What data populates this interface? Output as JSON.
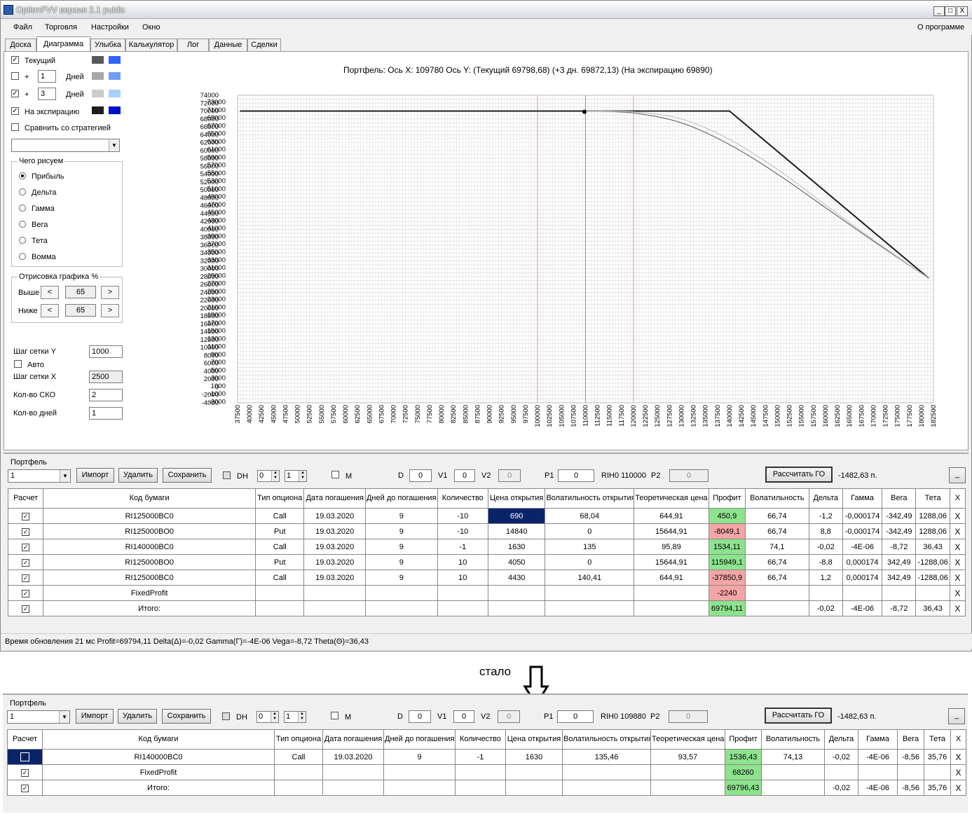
{
  "window": {
    "title": "OptionFVV версия 2.1 public",
    "min": "_",
    "max": "□",
    "close": "X"
  },
  "menu": {
    "file": "Файл",
    "trade": "Торговля",
    "settings": "Настройки",
    "window": "Окно",
    "about": "О программе"
  },
  "tabs": [
    "Доска",
    "Диаграмма",
    "Улыбка",
    "Калькулятор",
    "Лог",
    "Данные",
    "Сделки"
  ],
  "left": {
    "current": "Текущий",
    "plus": "+",
    "days": "Дней",
    "days1": "1",
    "days2": "3",
    "expiry": "На экспирацию",
    "compare": "Сравнить со стратегией",
    "what_title": "Чего рисуем",
    "what": [
      "Прибыль",
      "Дельта",
      "Гамма",
      "Вега",
      "Тета",
      "Вомма"
    ],
    "draw_title": "Отрисовка графика %",
    "above": "Выше",
    "below": "Ниже",
    "above_val": "65",
    "below_val": "65",
    "lt": "<",
    "gt": ">",
    "grid_y_label": "Шаг сетки Y",
    "grid_y": "1000",
    "auto": "Авто",
    "grid_x_label": "Шаг сетки X",
    "grid_x": "2500",
    "sko_label": "Кол-во СКО",
    "sko": "2",
    "ndays_label": "Кол-во дней",
    "ndays": "1",
    "colors": {
      "cur1": "#585858",
      "cur2": "#2f62ff",
      "d1a": "#a8a8a8",
      "d1b": "#6f9ef8",
      "d2a": "#cccccc",
      "d2b": "#a6d2ff",
      "ex1": "#1c1c1c",
      "ex2": "#0010c8"
    }
  },
  "chart_data": {
    "type": "line",
    "title": "Портфель: Ось X:  109780 Ось Y:   (Текущий 69798,68)  (+3 дн.  69872,13)  (На экспирацию 69890)",
    "y_left_ticks": [
      74000,
      72000,
      70000,
      68000,
      66000,
      64000,
      62000,
      60000,
      58000,
      56000,
      54000,
      52000,
      50000,
      48000,
      46000,
      44000,
      42000,
      40000,
      38000,
      36000,
      34000,
      32000,
      30000,
      28000,
      26000,
      24000,
      22000,
      20000,
      18000,
      16000,
      14000,
      12000,
      10000,
      8000,
      6000,
      4000,
      2000,
      0,
      -2000,
      -4000
    ],
    "y_right_ticks": [
      73000,
      71000,
      69000,
      67000,
      65000,
      63000,
      61000,
      59000,
      57000,
      55000,
      53000,
      51000,
      49000,
      47000,
      45000,
      43000,
      41000,
      39000,
      37000,
      35000,
      33000,
      31000,
      29000,
      27000,
      25000,
      23000,
      21000,
      19000,
      17000,
      15000,
      13000,
      11000,
      9000,
      7000,
      5000,
      3000,
      1000,
      -1000,
      -3000
    ],
    "x_ticks": [
      "37500",
      "40000",
      "42500",
      "45000",
      "47500",
      "50000",
      "52500",
      "55000",
      "57500",
      "60000",
      "62500",
      "65000",
      "67500",
      "70000",
      "72500",
      "75000",
      "77500",
      "80000",
      "82500",
      "85000",
      "87500",
      "90000",
      "92500",
      "95000",
      "97500",
      "100000",
      "102500",
      "105000",
      "107500",
      "110000",
      "112500",
      "115000",
      "117500",
      "120000",
      "122500",
      "125000",
      "127500",
      "130000",
      "132500",
      "135000",
      "137500",
      "140000",
      "142500",
      "145000",
      "147500",
      "150000",
      "152500",
      "155000",
      "157500",
      "160000",
      "162500",
      "165000",
      "167500",
      "170000",
      "172500",
      "175000",
      "177500",
      "180000",
      "182500"
    ],
    "xlim": [
      37500,
      182500
    ],
    "ylim": [
      -4000,
      74000
    ],
    "vlines": [
      {
        "x": 100000,
        "color": "#f0a0a0"
      },
      {
        "x": 110000,
        "color": "#8a9ab8"
      },
      {
        "x": 120000,
        "color": "#f0a0a0"
      }
    ],
    "marker": {
      "x": 109780,
      "y": 69798
    },
    "series": [
      {
        "style": "expiry",
        "x": [
          38000,
          140000,
          181500
        ],
        "y": [
          70000,
          70000,
          27600
        ]
      },
      {
        "style": "current",
        "x": [
          110000,
          120000,
          130000,
          140000,
          150000,
          160000,
          170000,
          181500
        ],
        "y": [
          70000,
          69500,
          67000,
          61500,
          54000,
          45500,
          37000,
          27600
        ]
      },
      {
        "style": "plus3",
        "x": [
          110000,
          120000,
          130000,
          140000,
          150000,
          160000,
          170000,
          181500
        ],
        "y": [
          70000,
          69800,
          68000,
          62800,
          55200,
          46200,
          37300,
          27600
        ]
      }
    ]
  },
  "portfolio1": {
    "title": "Портфель",
    "select": "1",
    "import": "Импорт",
    "delete": "Удалить",
    "save": "Сохранить",
    "dh": "DH",
    "spin1": "0",
    "spin2": "1",
    "m": "M",
    "d_label": "D",
    "d": "0",
    "v1_label": "V1",
    "v1": "0",
    "v2_label": "V2",
    "v2": "0",
    "p1_label": "P1",
    "p1": "0",
    "rih": "RIH0 110000",
    "p2_label": "P2",
    "p2": "0",
    "calc": "Рассчитать ГО",
    "go": "-1482,63 п.",
    "min": "_",
    "headers": [
      "Расчет",
      "Код бумаги",
      "Тип опциона",
      "Дата погашения",
      "Дней до погашения",
      "Количество",
      "Цена открытия",
      "Волатильность открытия",
      "Теоретическая цена",
      "Профит",
      "Волатильность",
      "Дельта",
      "Гамма",
      "Вега",
      "Тета",
      "X"
    ],
    "rows": [
      [
        "✓",
        "RI125000BC0",
        "Call",
        "19.03.2020",
        "9",
        "-10",
        "690",
        "68,04",
        "644,91",
        "450,9",
        "66,74",
        "-1,2",
        "-0,000174",
        "-342,49",
        "1288,06",
        "X"
      ],
      [
        "✓",
        "RI125000BO0",
        "Put",
        "19.03.2020",
        "9",
        "-10",
        "14840",
        "0",
        "15644,91",
        "-8049,1",
        "66,74",
        "8,8",
        "-0,000174",
        "-342,49",
        "1288,06",
        "X"
      ],
      [
        "✓",
        "RI140000BC0",
        "Call",
        "19.03.2020",
        "9",
        "-1",
        "1630",
        "135",
        "95,89",
        "1534,11",
        "74,1",
        "-0,02",
        "-4E-06",
        "-8,72",
        "36,43",
        "X"
      ],
      [
        "✓",
        "RI125000BO0",
        "Put",
        "19.03.2020",
        "9",
        "10",
        "4050",
        "0",
        "15644,91",
        "115949,1",
        "66,74",
        "-8,8",
        "0,000174",
        "342,49",
        "-1288,06",
        "X"
      ],
      [
        "✓",
        "RI125000BC0",
        "Call",
        "19.03.2020",
        "9",
        "10",
        "4430",
        "140,41",
        "644,91",
        "-37850,9",
        "66,74",
        "1,2",
        "0,000174",
        "342,49",
        "-1288,06",
        "X"
      ],
      [
        "✓",
        "FixedProfit",
        "",
        "",
        "",
        "",
        "",
        "",
        "",
        "-2240",
        "",
        "",
        "",
        "",
        "",
        "X"
      ],
      [
        "✓",
        "Итого:",
        "",
        "",
        "",
        "",
        "",
        "",
        "",
        "69794,11",
        "",
        "-0,02",
        "-4E-06",
        "-8,72",
        "36,43",
        "X"
      ]
    ],
    "status": "Время обновления 21 мс  Profit=69794,11 Delta(Δ)=-0,02 Gamma(Γ)=-4E-06 Vega=-8,72 Theta(Θ)=36,43"
  },
  "became": "стало",
  "portfolio2": {
    "title": "Портфель",
    "select": "1",
    "import": "Импорт",
    "delete": "Удалить",
    "save": "Сохранить",
    "dh": "DH",
    "spin1": "0",
    "spin2": "1",
    "m": "M",
    "d_label": "D",
    "d": "0",
    "v1_label": "V1",
    "v1": "0",
    "v2_label": "V2",
    "v2": "0",
    "p1_label": "P1",
    "p1": "0",
    "rih": "RIH0 109880",
    "p2_label": "P2",
    "p2": "0",
    "calc": "Рассчитать ГО",
    "go": "-1482,63 п.",
    "min": "_",
    "headers": [
      "Расчет",
      "Код бумаги",
      "Тип опциона",
      "Дата погашения",
      "Дней до погашения",
      "Количество",
      "Цена открытия",
      "Волатильность открытия",
      "Теоретическая цена",
      "Профит",
      "Волатильность",
      "Дельта",
      "Гамма",
      "Вега",
      "Тета",
      "X"
    ],
    "rows": [
      [
        "✓",
        "RI140000BC0",
        "Call",
        "19.03.2020",
        "9",
        "-1",
        "1630",
        "135,46",
        "93,57",
        "1536,43",
        "74,13",
        "-0,02",
        "-4E-06",
        "-8,56",
        "35,76",
        "X"
      ],
      [
        "✓",
        "FixedProfit",
        "",
        "",
        "",
        "",
        "",
        "",
        "",
        "68260",
        "",
        "",
        "",
        "",
        "",
        "X"
      ],
      [
        "✓",
        "Итого:",
        "",
        "",
        "",
        "",
        "",
        "",
        "",
        "69796,43",
        "",
        "-0,02",
        "-4E-06",
        "-8,56",
        "35,76",
        "X"
      ]
    ]
  }
}
